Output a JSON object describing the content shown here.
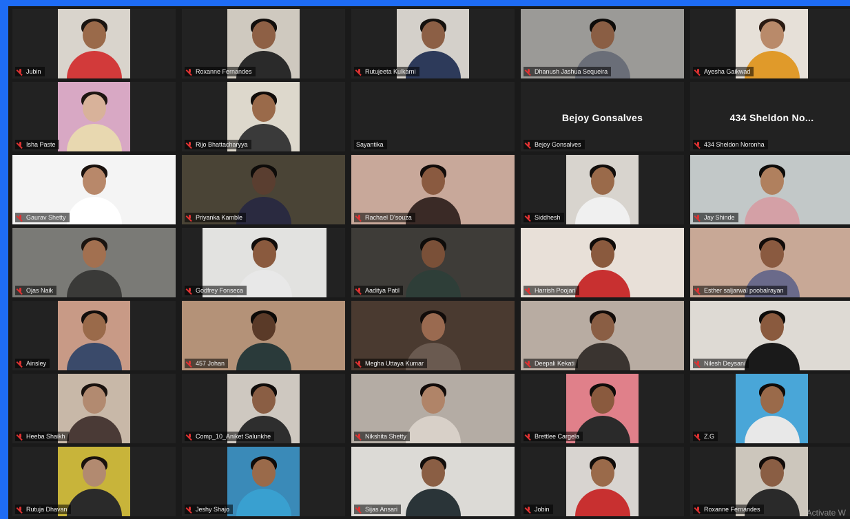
{
  "meeting": {
    "watermark": "Activate W",
    "participants": [
      {
        "name": "Jubin",
        "muted": true,
        "video": "center",
        "bg": "#d9d4cc",
        "skin": "#9a6a4a",
        "shirt": "#d23a3a",
        "hair": "#1a1410"
      },
      {
        "name": "Roxanne Fernandes",
        "muted": true,
        "video": "center",
        "bg": "#cfc9bf",
        "skin": "#8e6045",
        "shirt": "#2a2a2a",
        "hair": "#120e0c"
      },
      {
        "name": "Rutujeeta Kulkarni",
        "muted": true,
        "video": "center",
        "bg": "#d4d0ca",
        "skin": "#8c5f45",
        "shirt": "#2d3a5a",
        "hair": "#15110e"
      },
      {
        "name": "Dhanush Jashua Sequeira",
        "muted": true,
        "video": "wide",
        "bg": "#9b9a97",
        "skin": "#8a5e44",
        "shirt": "#6a6e78",
        "hair": "#0e0c0a"
      },
      {
        "name": "Ayesha Gaikwad",
        "muted": true,
        "video": "center",
        "bg": "#e6e0d8",
        "skin": "#b98a6a",
        "shirt": "#e09a2a",
        "hair": "#2a1a12"
      },
      {
        "name": "Isha Paste",
        "muted": true,
        "video": "center",
        "bg": "#d8a8c4",
        "skin": "#d8b29a",
        "shirt": "#e8d8b0",
        "hair": "#1e1612"
      },
      {
        "name": "Rijo Bhattacharyya",
        "muted": true,
        "video": "center",
        "bg": "#ddd8cc",
        "skin": "#9a6a4a",
        "shirt": "#3a3a3a",
        "hair": "#100c0a"
      },
      {
        "name": "Sayantika",
        "muted": false,
        "video": "none",
        "bg": "#222",
        "skin": "",
        "shirt": "",
        "hair": "",
        "big": ""
      },
      {
        "name": "Bejoy Gonsalves",
        "muted": true,
        "video": "none",
        "bg": "#222",
        "skin": "",
        "shirt": "",
        "hair": "",
        "big": "Bejoy Gonsalves"
      },
      {
        "name": "434 Sheldon Noronha",
        "muted": true,
        "video": "none",
        "bg": "#222",
        "skin": "",
        "shirt": "",
        "hair": "",
        "big": "434 Sheldon No..."
      },
      {
        "name": "Gaurav Shetty",
        "muted": true,
        "video": "full",
        "bg": "#f4f4f4",
        "skin": "#b8886a",
        "shirt": "#ffffff",
        "hair": "#1a120e"
      },
      {
        "name": "Priyanka Kamble",
        "muted": true,
        "video": "full",
        "bg": "#4a4436",
        "skin": "#5a3e30",
        "shirt": "#2a2a40",
        "hair": "#0e0c0a"
      },
      {
        "name": "Rachael D'souza",
        "muted": true,
        "video": "full",
        "bg": "#c8a89a",
        "skin": "#8a5a40",
        "shirt": "#3a2a26",
        "hair": "#120c0a"
      },
      {
        "name": "Siddhesh",
        "muted": true,
        "video": "center",
        "bg": "#d8d4ce",
        "skin": "#9a6a4a",
        "shirt": "#f0f0f0",
        "hair": "#120e0c"
      },
      {
        "name": "Jay Shinde",
        "muted": true,
        "video": "full",
        "bg": "#c2c8c8",
        "skin": "#b0805e",
        "shirt": "#d4a0a6",
        "hair": "#0e0c0a"
      },
      {
        "name": "Ojas Naik",
        "muted": true,
        "video": "full",
        "bg": "#7a7a76",
        "skin": "#a27050",
        "shirt": "#3a3a38",
        "hair": "#1a1410"
      },
      {
        "name": "Godfrey Fonseca",
        "muted": true,
        "video": "center-wide",
        "bg": "#e2e2e0",
        "skin": "#8a5a3e",
        "shirt": "#e8e8e8",
        "hair": "#100c0a"
      },
      {
        "name": "Aaditya Patil",
        "muted": true,
        "video": "full",
        "bg": "#3e3c38",
        "skin": "#7a5038",
        "shirt": "#2e3e38",
        "hair": "#0e0c0a"
      },
      {
        "name": "Harrish Poojari",
        "muted": true,
        "video": "full",
        "bg": "#e8e0d8",
        "skin": "#8a5a3e",
        "shirt": "#c83030",
        "hair": "#100c0a"
      },
      {
        "name": "Esther saljarwal poobalrayan",
        "muted": true,
        "video": "full",
        "bg": "#c8a896",
        "skin": "#8a5a40",
        "shirt": "#6a6a8a",
        "hair": "#120c0a"
      },
      {
        "name": "Ainsley",
        "muted": true,
        "video": "center",
        "bg": "#c89a86",
        "skin": "#9a6a4a",
        "shirt": "#3a4a6a",
        "hair": "#120e0c"
      },
      {
        "name": "457 Johan",
        "muted": true,
        "video": "full",
        "bg": "#b49278",
        "skin": "#5a3a28",
        "shirt": "#2a3a3a",
        "hair": "#0c0a08"
      },
      {
        "name": "Megha Uttaya Kumar",
        "muted": true,
        "video": "full",
        "bg": "#4a3a30",
        "skin": "#9a6a50",
        "shirt": "#6a5a50",
        "hair": "#120c0a"
      },
      {
        "name": "Deepali Kekati",
        "muted": true,
        "video": "full",
        "bg": "#b8aca2",
        "skin": "#8a5e44",
        "shirt": "#3a3430",
        "hair": "#120c0a"
      },
      {
        "name": "Nilesh Deysani",
        "muted": true,
        "video": "full",
        "bg": "#dedad4",
        "skin": "#8a5a3e",
        "shirt": "#1a1a1a",
        "hair": "#0e0c0a"
      },
      {
        "name": "Heeba Shaikh",
        "muted": true,
        "video": "center",
        "bg": "#c8b8a8",
        "skin": "#b28a70",
        "shirt": "#4a3a36",
        "hair": "#1a120e"
      },
      {
        "name": "Comp_10_Aniket Salunkhe",
        "muted": true,
        "video": "center",
        "bg": "#cec8c0",
        "skin": "#8a5e44",
        "shirt": "#2e2e2e",
        "hair": "#100c0a"
      },
      {
        "name": "Nikshita Shetty",
        "muted": true,
        "video": "full",
        "bg": "#b4aca4",
        "skin": "#b08468",
        "shirt": "#d8d0c8",
        "hair": "#120c0a"
      },
      {
        "name": "Brettlee Cargela",
        "muted": true,
        "video": "center",
        "bg": "#e0808a",
        "skin": "#8a5a3e",
        "shirt": "#2a2a2a",
        "hair": "#100c0a"
      },
      {
        "name": "Z.G",
        "muted": true,
        "video": "center",
        "bg": "#49a6d8",
        "skin": "#9a6a4a",
        "shirt": "#e8e8e8",
        "hair": "#100c0a"
      },
      {
        "name": "Rutuja Dhavan",
        "muted": true,
        "video": "center",
        "bg": "#c8b43a",
        "skin": "#b28a70",
        "shirt": "#2a2a2a",
        "hair": "#1a120e"
      },
      {
        "name": "Jeshy Shajo",
        "muted": true,
        "video": "center",
        "bg": "#3a8ab8",
        "skin": "#9a6a4a",
        "shirt": "#39a0d0",
        "hair": "#100c0a"
      },
      {
        "name": "Sijas Ansari",
        "muted": true,
        "video": "full",
        "bg": "#dcdad6",
        "skin": "#8a5e44",
        "shirt": "#2a3438",
        "hair": "#120e0c"
      },
      {
        "name": "Jobin",
        "muted": true,
        "video": "center",
        "bg": "#d8d4d0",
        "skin": "#9a6a4a",
        "shirt": "#c83030",
        "hair": "#100c0a"
      },
      {
        "name": "Roxanne Fernandes",
        "muted": true,
        "video": "center",
        "bg": "#ccc6bc",
        "skin": "#8a5e44",
        "shirt": "#2a2a2a",
        "hair": "#120c0a"
      }
    ]
  }
}
